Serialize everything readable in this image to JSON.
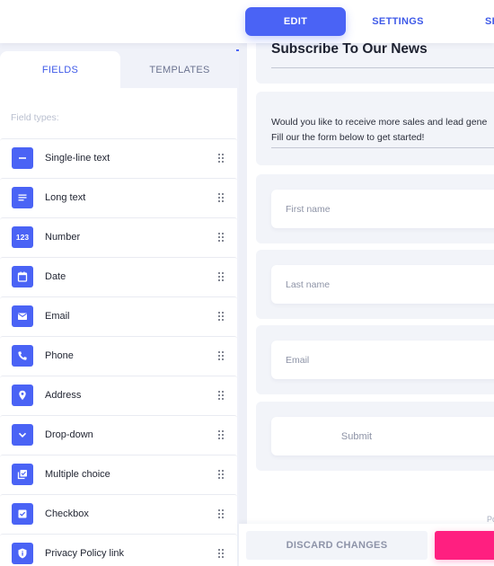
{
  "top_tabs": [
    {
      "label": "EDIT",
      "active": true
    },
    {
      "label": "SETTINGS",
      "active": false
    },
    {
      "label": "SH",
      "active": false
    }
  ],
  "left_panel": {
    "tabs": [
      {
        "label": "FIELDS",
        "active": true
      },
      {
        "label": "TEMPLATES",
        "active": false
      }
    ],
    "section_label": "Field types:",
    "field_types": [
      {
        "label": "Single-line text",
        "icon": "minus-icon"
      },
      {
        "label": "Long text",
        "icon": "text-lines-icon"
      },
      {
        "label": "Number",
        "icon": "number-123-icon"
      },
      {
        "label": "Date",
        "icon": "calendar-icon"
      },
      {
        "label": "Email",
        "icon": "envelope-icon"
      },
      {
        "label": "Phone",
        "icon": "phone-icon"
      },
      {
        "label": "Address",
        "icon": "map-pin-icon"
      },
      {
        "label": "Drop-down",
        "icon": "chevron-down-icon"
      },
      {
        "label": "Multiple choice",
        "icon": "multi-check-icon"
      },
      {
        "label": "Checkbox",
        "icon": "checkbox-icon"
      },
      {
        "label": "Privacy Policy link",
        "icon": "shield-info-icon"
      }
    ],
    "number_icon_text": "123"
  },
  "form": {
    "title": "Subscribe To Our News",
    "description_line1": "Would you like to receive more sales and lead gene",
    "description_line2": "Fill our the form below to get started!",
    "fields": [
      {
        "placeholder": "First name"
      },
      {
        "placeholder": "Last name"
      },
      {
        "placeholder": "Email"
      }
    ],
    "submit_label": "Submit",
    "powered_by": "Po"
  },
  "bottom_bar": {
    "discard_label": "DISCARD CHANGES",
    "save_label": ""
  },
  "colors": {
    "accent": "#4a63f5",
    "save": "#ff1f80",
    "panel_bg": "#f0f2f9"
  }
}
